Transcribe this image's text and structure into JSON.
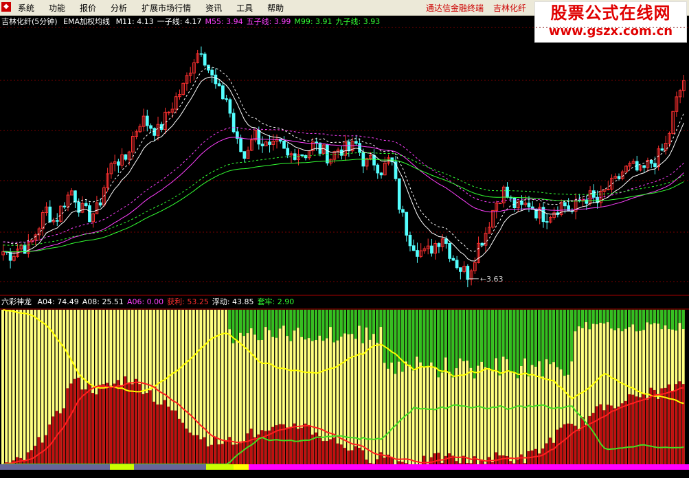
{
  "menu": {
    "items": [
      "系统",
      "功能",
      "报价",
      "分析",
      "扩展市场行情",
      "资讯",
      "工具",
      "帮助"
    ],
    "right_links": [
      "通达信金融终端",
      "吉林化纤"
    ]
  },
  "watermark": {
    "title": "股票公式在线网",
    "url": "www.gszx.com.cn"
  },
  "main_panel": {
    "title": "吉林化纤(5分钟)",
    "indicator_name": "EMA加权均线",
    "lines": [
      {
        "label": "M11: 4.13",
        "color": "#ffffff"
      },
      {
        "label": "一子线: 4.17",
        "color": "#ffffff"
      },
      {
        "label": "M55: 3.94",
        "color": "#ff40ff"
      },
      {
        "label": "五子线: 3.99",
        "color": "#ff40ff"
      },
      {
        "label": "M99: 3.91",
        "color": "#33ff33"
      },
      {
        "label": "九子线: 3.93",
        "color": "#33ff33"
      }
    ],
    "low_marker": "3.63"
  },
  "sub_panel": {
    "title": "六彩神龙",
    "lines": [
      {
        "label": "A04: 74.49",
        "color": "#ffffff"
      },
      {
        "label": "A08: 25.51",
        "color": "#ffffff"
      },
      {
        "label": "A06: 0.00",
        "color": "#ff40ff"
      },
      {
        "label": "获利: 53.25",
        "color": "#ff3030"
      },
      {
        "label": "浮动: 43.85",
        "color": "#ffffff"
      },
      {
        "label": "套牢: 2.90",
        "color": "#33ff33"
      }
    ]
  },
  "colors": {
    "bull": "#ff3030",
    "bear": "#54ffff",
    "grid": "#7a0000",
    "yellow_area": "#ffff80",
    "red_area": "#c01010",
    "green_area": "#33c020"
  },
  "chart_data": {
    "type": "candlestick",
    "low_label_value": 3.63,
    "price_series": [
      3.71,
      3.7,
      3.73,
      3.72,
      3.78,
      3.84,
      3.8,
      3.86,
      3.9,
      3.84,
      3.82,
      3.84,
      3.94,
      4.0,
      3.98,
      4.06,
      4.12,
      4.1,
      4.08,
      4.13,
      4.18,
      4.22,
      4.3,
      4.34,
      4.26,
      4.2,
      4.18,
      4.05,
      4.0,
      4.08,
      4.05,
      4.02,
      4.04,
      4.0,
      4.02,
      4.01,
      4.04,
      4.02,
      4.0,
      4.03,
      4.02,
      4.04,
      3.98,
      3.99,
      3.96,
      4.0,
      3.85,
      3.76,
      3.72,
      3.7,
      3.73,
      3.76,
      3.7,
      3.66,
      3.64,
      3.72,
      3.77,
      3.85,
      3.9,
      3.86,
      3.84,
      3.86,
      3.83,
      3.82,
      3.84,
      3.86,
      3.83,
      3.87,
      3.88,
      3.86,
      3.9,
      3.92,
      3.96,
      3.97,
      3.95,
      3.98,
      4.0,
      4.04,
      4.16,
      4.24
    ],
    "sub_ratio_series": [
      0.0,
      0.0,
      0.02,
      0.05,
      0.12,
      0.22,
      0.28,
      0.38,
      0.55,
      0.52,
      0.5,
      0.48,
      0.5,
      0.52,
      0.55,
      0.55,
      0.5,
      0.48,
      0.4,
      0.38,
      0.33,
      0.28,
      0.22,
      0.18,
      0.15,
      0.14,
      0.14,
      0.16,
      0.18,
      0.2,
      0.2,
      0.2,
      0.22,
      0.25,
      0.26,
      0.25,
      0.22,
      0.18,
      0.16,
      0.14,
      0.12,
      0.08,
      0.06,
      0.04,
      0.06,
      0.05,
      0.02,
      0.0,
      0.0,
      0.02,
      0.03,
      0.04,
      0.04,
      0.03,
      0.02,
      0.02,
      0.03,
      0.04,
      0.05,
      0.04,
      0.03,
      0.05,
      0.08,
      0.12,
      0.18,
      0.22,
      0.24,
      0.26,
      0.3,
      0.34,
      0.38,
      0.4,
      0.42,
      0.42,
      0.44,
      0.46,
      0.46,
      0.48,
      0.5,
      0.5
    ]
  }
}
